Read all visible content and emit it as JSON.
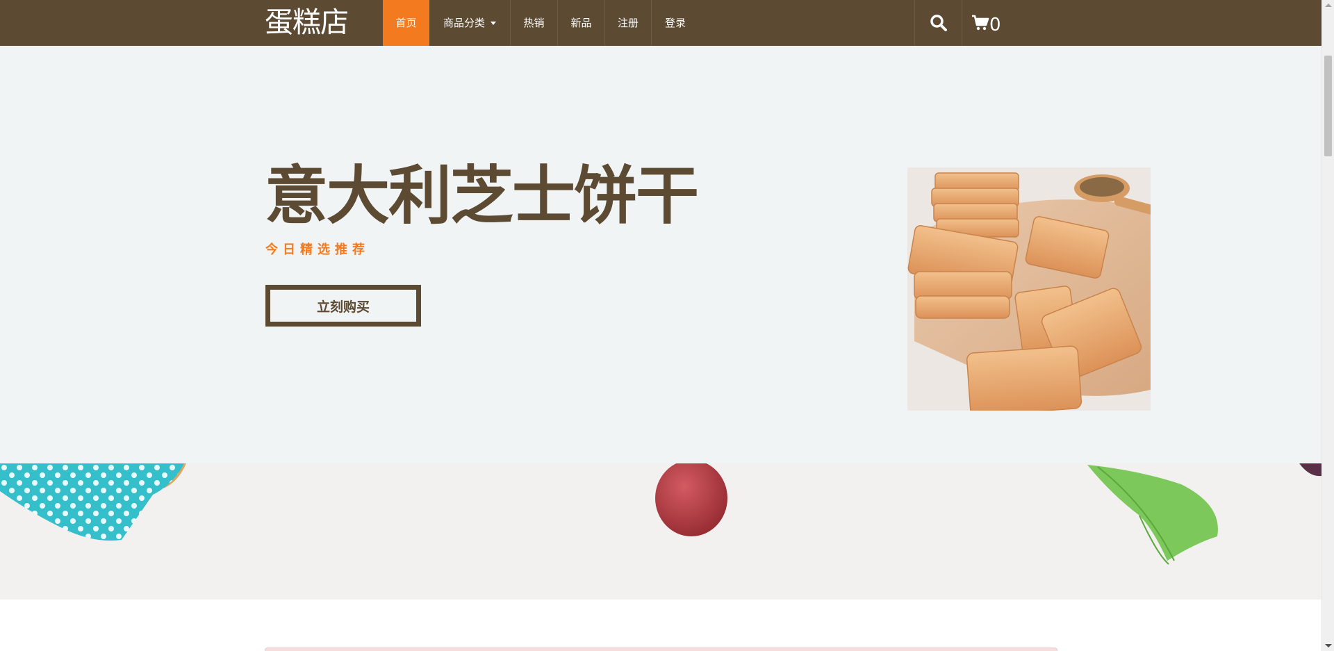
{
  "navbar": {
    "brand": "蛋糕店",
    "items": [
      {
        "label": "首页",
        "active": true
      },
      {
        "label": "商品分类",
        "dropdown": true
      },
      {
        "label": "热销"
      },
      {
        "label": "新品"
      },
      {
        "label": "注册"
      },
      {
        "label": "登录"
      }
    ],
    "search_icon": "search-icon",
    "cart_icon": "cart-icon",
    "cart_count": "0"
  },
  "hero": {
    "title": "意大利芝士饼干",
    "subtitle": "今日精选推荐",
    "button_label": "立刻购买",
    "image": "cookie-product-image"
  },
  "colors": {
    "brand_brown": "#5c4a32",
    "accent_orange": "#f47a20",
    "hero_bg": "#f1f4f5"
  }
}
